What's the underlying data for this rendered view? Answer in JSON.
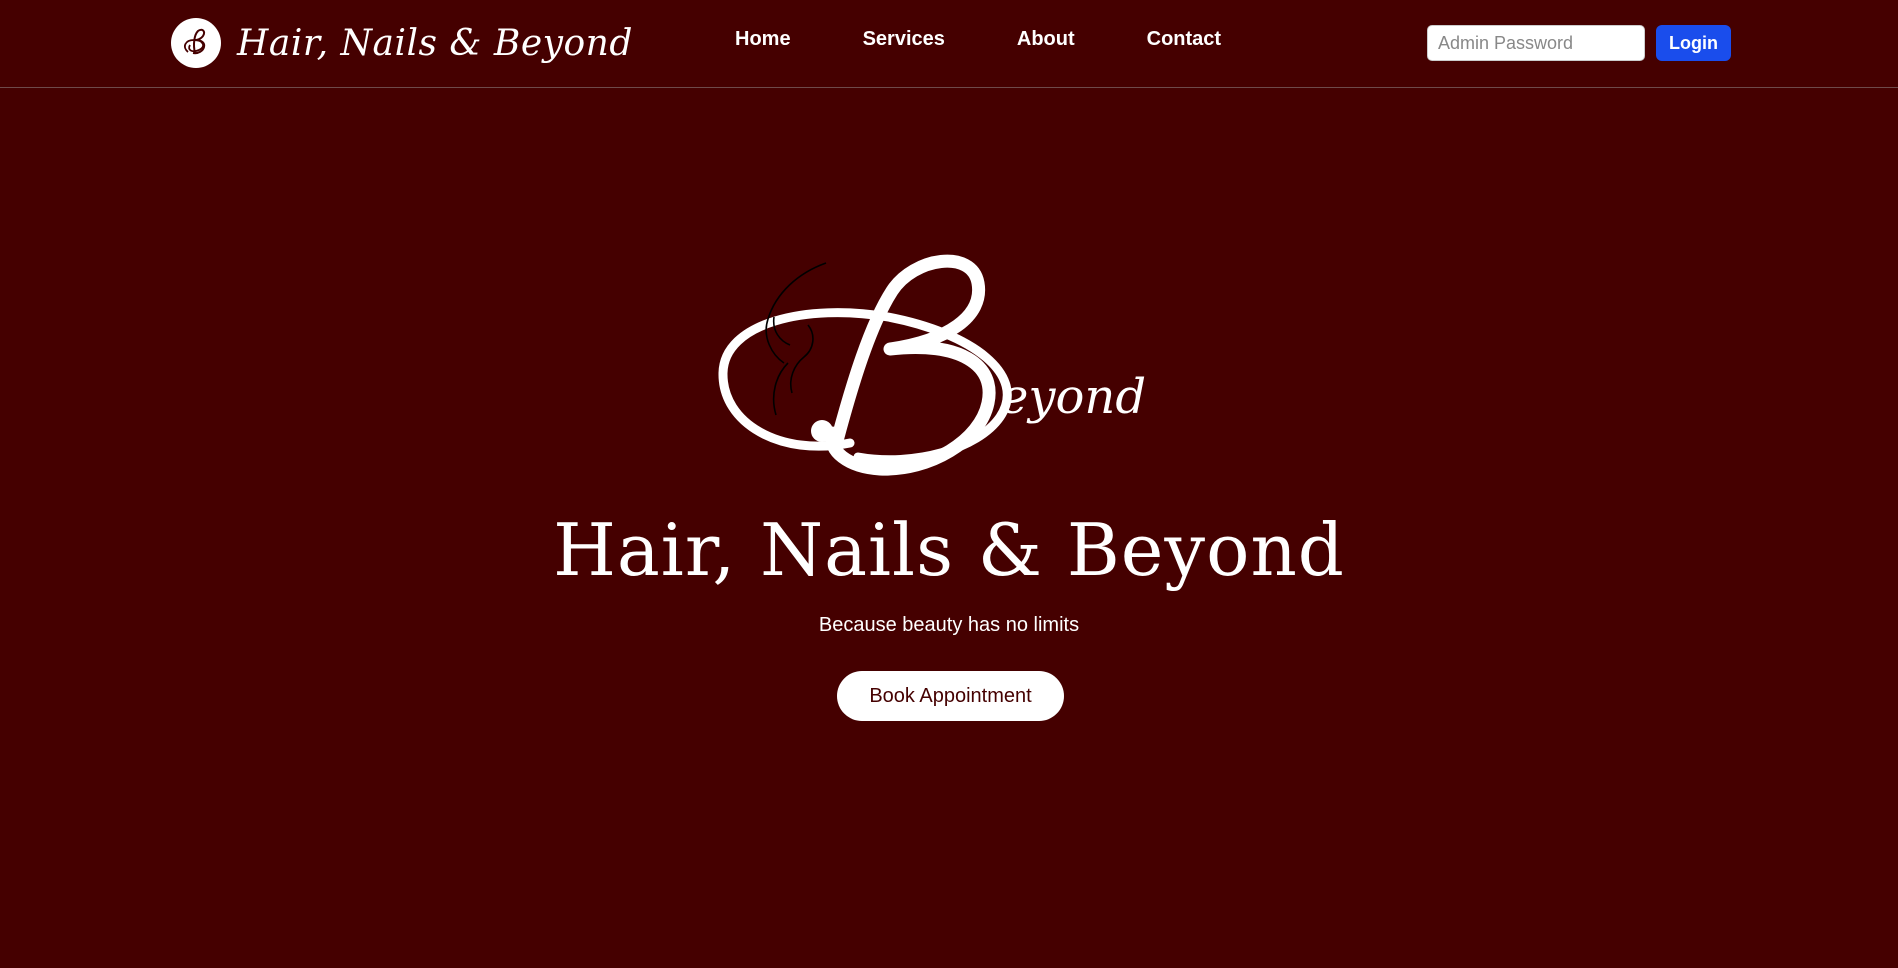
{
  "colors": {
    "background": "#450000",
    "accent_button": "#1a4dec",
    "text": "#ffffff",
    "book_button_text": "#450000"
  },
  "header": {
    "brand_name": "Hair, Nails & Beyond",
    "brand_logo_icon": "beyond-monogram-icon",
    "nav": [
      {
        "label": "Home"
      },
      {
        "label": "Services"
      },
      {
        "label": "About"
      },
      {
        "label": "Contact"
      }
    ],
    "admin_password_placeholder": "Admin Password",
    "admin_password_value": "",
    "login_label": "Login"
  },
  "hero": {
    "logo_icon": "beyond-logo-icon",
    "logo_text": "eyond",
    "title": "Hair, Nails & Beyond",
    "tagline": "Because beauty has no limits",
    "cta_label": "Book Appointment"
  }
}
